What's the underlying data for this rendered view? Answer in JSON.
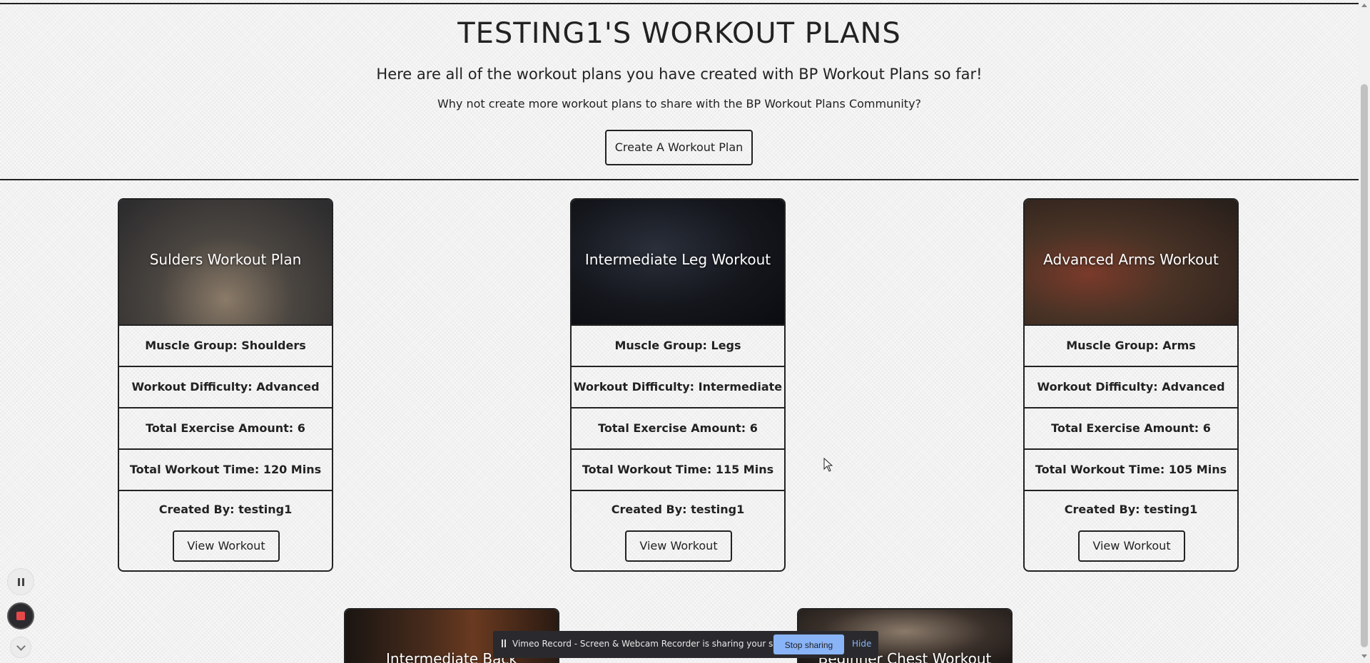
{
  "hero": {
    "title": "TESTING1'S WORKOUT PLANS",
    "lead": "Here are all of the workout plans you have created with BP Workout Plans so far!",
    "sub": "Why not create more workout plans to share with the BP Workout Plans Community?",
    "create_button": "Create A Workout Plan"
  },
  "cards": [
    {
      "title": "Sulders Workout Plan",
      "muscle_group": "Muscle Group: Shoulders",
      "difficulty": "Workout Difficulty: Advanced",
      "exercises": "Total Exercise Amount: 6",
      "time": "Total Workout Time: 120 Mins",
      "created_by": "Created By: testing1",
      "view_button": "View Workout"
    },
    {
      "title": "Intermediate Leg Workout",
      "muscle_group": "Muscle Group: Legs",
      "difficulty": "Workout Difficulty: Intermediate",
      "exercises": "Total Exercise Amount: 6",
      "time": "Total Workout Time: 115 Mins",
      "created_by": "Created By: testing1",
      "view_button": "View Workout"
    },
    {
      "title": "Advanced Arms Workout",
      "muscle_group": "Muscle Group: Arms",
      "difficulty": "Workout Difficulty: Advanced",
      "exercises": "Total Exercise Amount: 6",
      "time": "Total Workout Time: 105 Mins",
      "created_by": "Created By: testing1",
      "view_button": "View Workout"
    }
  ],
  "partial_cards": [
    {
      "title": "Intermediate Back"
    },
    {
      "title": "Beginner Chest Workout"
    }
  ],
  "share_bar": {
    "message": "Vimeo Record - Screen & Webcam Recorder is sharing your screen.",
    "stop_button": "Stop sharing",
    "hide_link": "Hide"
  },
  "colors": {
    "text": "#222222",
    "border": "#222222",
    "share_bar_bg": "#2a2a2e",
    "stop_button_bg": "#8ab4f8",
    "record_stop": "#e54848"
  }
}
